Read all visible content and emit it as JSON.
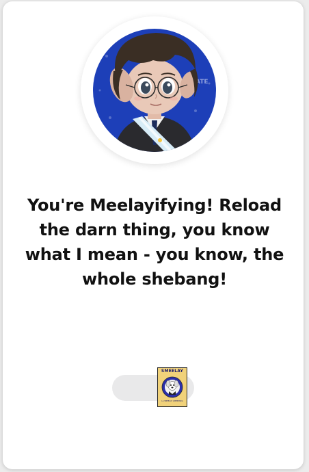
{
  "card": {
    "message": "You're Meelayifying! Reload the darn thing, you know what I mean - you know, the whole shebang!"
  },
  "avatar": {
    "icon": "cartoon-portrait-avatar",
    "colors": {
      "background": "#1d3fb8",
      "hair": "#3a2e24",
      "skin": "#e9c9b8",
      "suit": "#2a2a2e",
      "sash": "#d7ecf7"
    }
  },
  "reload": {
    "badge_title": "SMEELAY",
    "badge_caption": "LA SMEELAY LIBERTARIA",
    "colors": {
      "pill": "#e9e9ea",
      "badge_bg": "#f1d27a",
      "badge_border": "#2a2a2a"
    }
  }
}
